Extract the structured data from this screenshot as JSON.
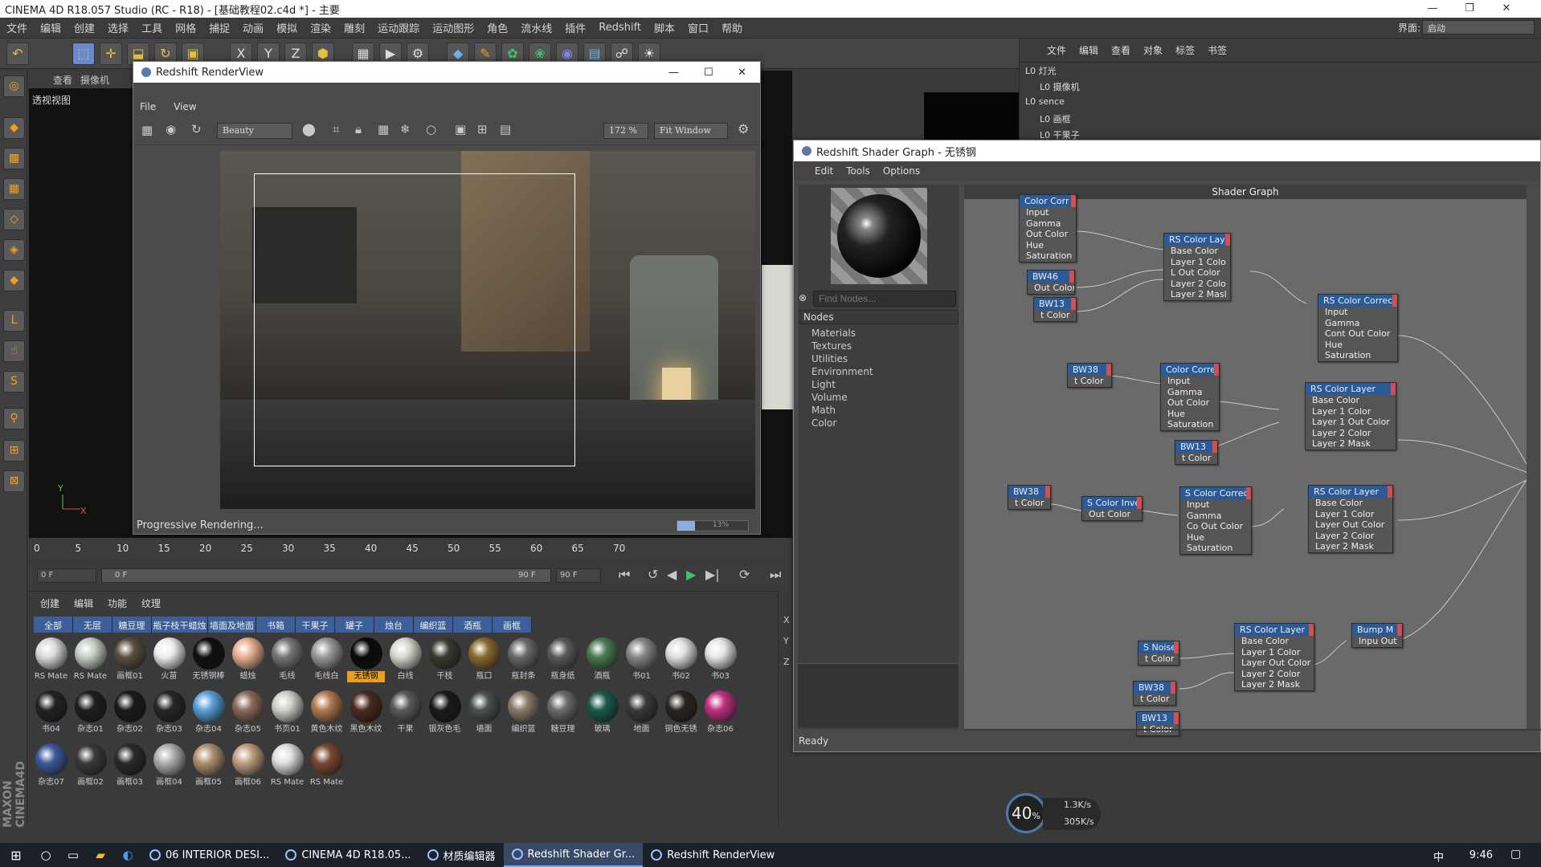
{
  "app": {
    "title": "CINEMA 4D R18.057 Studio (RC - R18) - [基础教程02.c4d *] - 主要"
  },
  "menubar": [
    "文件",
    "编辑",
    "创建",
    "选择",
    "工具",
    "网格",
    "捕捉",
    "动画",
    "模拟",
    "渲染",
    "雕刻",
    "运动跟踪",
    "运动图形",
    "角色",
    "流水线",
    "插件",
    "Redshift",
    "脚本",
    "窗口",
    "帮助"
  ],
  "layout": {
    "label": "界面:",
    "value": "启动"
  },
  "viewport": {
    "menus": [
      "查看",
      "摄像机"
    ],
    "name": "透视视图",
    "axis_y": "Y",
    "axis_x": "X"
  },
  "renderview": {
    "title": "Redshift RenderView",
    "menus": [
      "File",
      "View"
    ],
    "aov": "Beauty",
    "zoom": "172 %",
    "fit": "Fit Window",
    "status": "Progressive Rendering...",
    "progress_label": "13%",
    "progress": 0.25
  },
  "timeline": {
    "ticks": [
      "0",
      "5",
      "10",
      "15",
      "20",
      "25",
      "30",
      "35",
      "40",
      "45",
      "50",
      "55",
      "60",
      "65",
      "70"
    ]
  },
  "playbar": {
    "current": "0 F",
    "start": "0 F",
    "end": "90 F",
    "max": "90 F"
  },
  "material_manager": {
    "menus": [
      "创建",
      "编辑",
      "功能",
      "纹理"
    ],
    "tabs": [
      "全部",
      "无层",
      "糖豆理",
      "瓶子枝干蜡烛",
      "墙面及地面",
      "书箱",
      "干果子",
      "罐子",
      "烛台",
      "编织篮",
      "酒瓶",
      "画框"
    ],
    "materials": [
      {
        "name": "RS Mate",
        "color": "#dcdcdc"
      },
      {
        "name": "RS Mate",
        "color": "#c8d0c4"
      },
      {
        "name": "画框01",
        "color": "#5a5040"
      },
      {
        "name": "火苗",
        "color": "#eeeeee"
      },
      {
        "name": "无锈钢棒",
        "color": "#101010"
      },
      {
        "name": "蜡烛",
        "color": "#e8b090"
      },
      {
        "name": "毛线",
        "color": "#777777"
      },
      {
        "name": "毛线白",
        "color": "#9a9a9a"
      },
      {
        "name": "无锈钢",
        "color": "#0a0a0a",
        "selected": true
      },
      {
        "name": "白线",
        "color": "#d8d8d0"
      },
      {
        "name": "干枝",
        "color": "#3a3a30"
      },
      {
        "name": "瓶口",
        "color": "#8a6a30"
      },
      {
        "name": "瓶封条",
        "color": "#6a6a6a"
      },
      {
        "name": "瓶身纸",
        "color": "#5a5a5a"
      },
      {
        "name": "酒瓶",
        "color": "#4a7a50"
      },
      {
        "name": "书01",
        "color": "#888888"
      },
      {
        "name": "书02",
        "color": "#e0e0e0"
      },
      {
        "name": "书03",
        "color": "#e6e6e6"
      },
      {
        "name": "书04",
        "color": "#222222"
      },
      {
        "name": "杂志01",
        "color": "#1e1e1e"
      },
      {
        "name": "杂志02",
        "color": "#1a1a1a"
      },
      {
        "name": "杂志03",
        "color": "#262626"
      },
      {
        "name": "杂志04",
        "color": "#5aa0d8"
      },
      {
        "name": "杂志05",
        "color": "#8a6a5a"
      },
      {
        "name": "书页01",
        "color": "#d0d0c8"
      },
      {
        "name": "黄色木纹",
        "color": "#b07a50"
      },
      {
        "name": "黑色木纹",
        "color": "#4a2a1e"
      },
      {
        "name": "干果",
        "color": "#5a5a5a"
      },
      {
        "name": "银灰色毛",
        "color": "#1a1a1a"
      },
      {
        "name": "墙面",
        "color": "#4a5050"
      },
      {
        "name": "编织篮",
        "color": "#8a7a6a"
      },
      {
        "name": "糖豆理",
        "color": "#6a6a6a"
      },
      {
        "name": "玻璃",
        "color": "#1a5a4a"
      },
      {
        "name": "地面",
        "color": "#3a3a3a"
      },
      {
        "name": "铜色无锈",
        "color": "#2a2420"
      },
      {
        "name": "杂志06",
        "color": "#c03080"
      },
      {
        "name": "杂志07",
        "color": "#3a5a9a"
      },
      {
        "name": "画框02",
        "color": "#3a3a3a"
      },
      {
        "name": "画框03",
        "color": "#2a2a2a"
      },
      {
        "name": "画框04",
        "color": "#b0b0b0"
      },
      {
        "name": "画框05",
        "color": "#b09070"
      },
      {
        "name": "画框06",
        "color": "#c0a080"
      },
      {
        "name": "RS Mate",
        "color": "#e0e0e0"
      },
      {
        "name": "RS Mate",
        "color": "#7a4a30"
      }
    ]
  },
  "object_manager": {
    "menus": [
      "文件",
      "编辑",
      "查看",
      "对象",
      "标签",
      "书签"
    ],
    "rows": [
      "灯光",
      "摄像机",
      "sence",
      "画框",
      "干果子"
    ]
  },
  "shader_graph": {
    "title": "Redshift Shader Graph - 无锈钢",
    "menus": [
      "Edit",
      "Tools",
      "Options"
    ],
    "find_placeholder": "Find Nodes...",
    "tree_header": "Nodes",
    "tree": [
      "Materials",
      "Textures",
      "Utilities",
      "Environment",
      "Light",
      "Volume",
      "Math",
      "Color"
    ],
    "canvas_title": "Shader Graph",
    "status": "Ready",
    "nodes": [
      {
        "title": "Color Corr",
        "ports": [
          "Input",
          "Gamma",
          "Out Color",
          "Hue",
          "Saturation"
        ]
      },
      {
        "title": "RS Color Laye",
        "ports": [
          "Base Color",
          "Layer 1 Colo",
          "L Out Color",
          "Layer 2 Colo",
          "Layer 2 Masl"
        ]
      },
      {
        "title": "BW46",
        "ports": [
          "Out Color"
        ]
      },
      {
        "title": "BW13",
        "ports": [
          "t Color"
        ]
      },
      {
        "title": "RS Color Correct",
        "ports": [
          "Input",
          "Gamma",
          "Cont Out Color",
          "Hue",
          "Saturation"
        ]
      },
      {
        "title": "BW38",
        "ports": [
          "t Color"
        ]
      },
      {
        "title": "Color Corre",
        "ports": [
          "Input",
          "Gamma",
          "Out Color",
          "Hue",
          "Saturation"
        ]
      },
      {
        "title": "RS Color Layer",
        "ports": [
          "Base Color",
          "Layer 1 Color",
          "Layer 1  Out Color",
          "Layer 2 Color",
          "Layer 2 Mask"
        ]
      },
      {
        "title": "BW13",
        "ports": [
          "t Color"
        ]
      },
      {
        "title": "BW38",
        "ports": [
          "t Color"
        ]
      },
      {
        "title": "S Color Inve",
        "ports": [
          "Out Color"
        ]
      },
      {
        "title": "S Color Correc",
        "ports": [
          "Input",
          "Gamma",
          "Co Out Color",
          "Hue",
          "Saturation"
        ]
      },
      {
        "title": "RS Color Layer",
        "ports": [
          "Base Color",
          "Layer 1 Color",
          "Layer Out Color",
          "Layer 2 Color",
          "Layer 2 Mask"
        ]
      },
      {
        "title": "S Noise",
        "ports": [
          "t Color"
        ]
      },
      {
        "title": "RS Color Layer",
        "ports": [
          "Base Color",
          "Layer 1 Color",
          "Layer Out Color",
          "Layer 2 Color",
          "Layer 2 Mask"
        ]
      },
      {
        "title": "Bump M",
        "ports": [
          "Inpu Out"
        ]
      },
      {
        "title": "BW38",
        "ports": [
          "t Color"
        ]
      },
      {
        "title": "BW13",
        "ports": [
          "t Color"
        ]
      }
    ]
  },
  "net_widget": {
    "percent": "40",
    "unit": "%",
    "up": "1.3K/s",
    "down": "305K/s"
  },
  "taskbar": {
    "items": [
      {
        "label": "06 INTERIOR DESI..."
      },
      {
        "label": "CINEMA 4D R18.05..."
      },
      {
        "label": "材质编辑器"
      },
      {
        "label": "Redshift Shader Gr...",
        "active": true
      },
      {
        "label": "Redshift RenderView"
      }
    ],
    "ime": "中",
    "time": "9:46"
  },
  "colors": {
    "accent": "#2b5a9b",
    "selected": "#e8a020",
    "tab": "#3c5f9a"
  }
}
